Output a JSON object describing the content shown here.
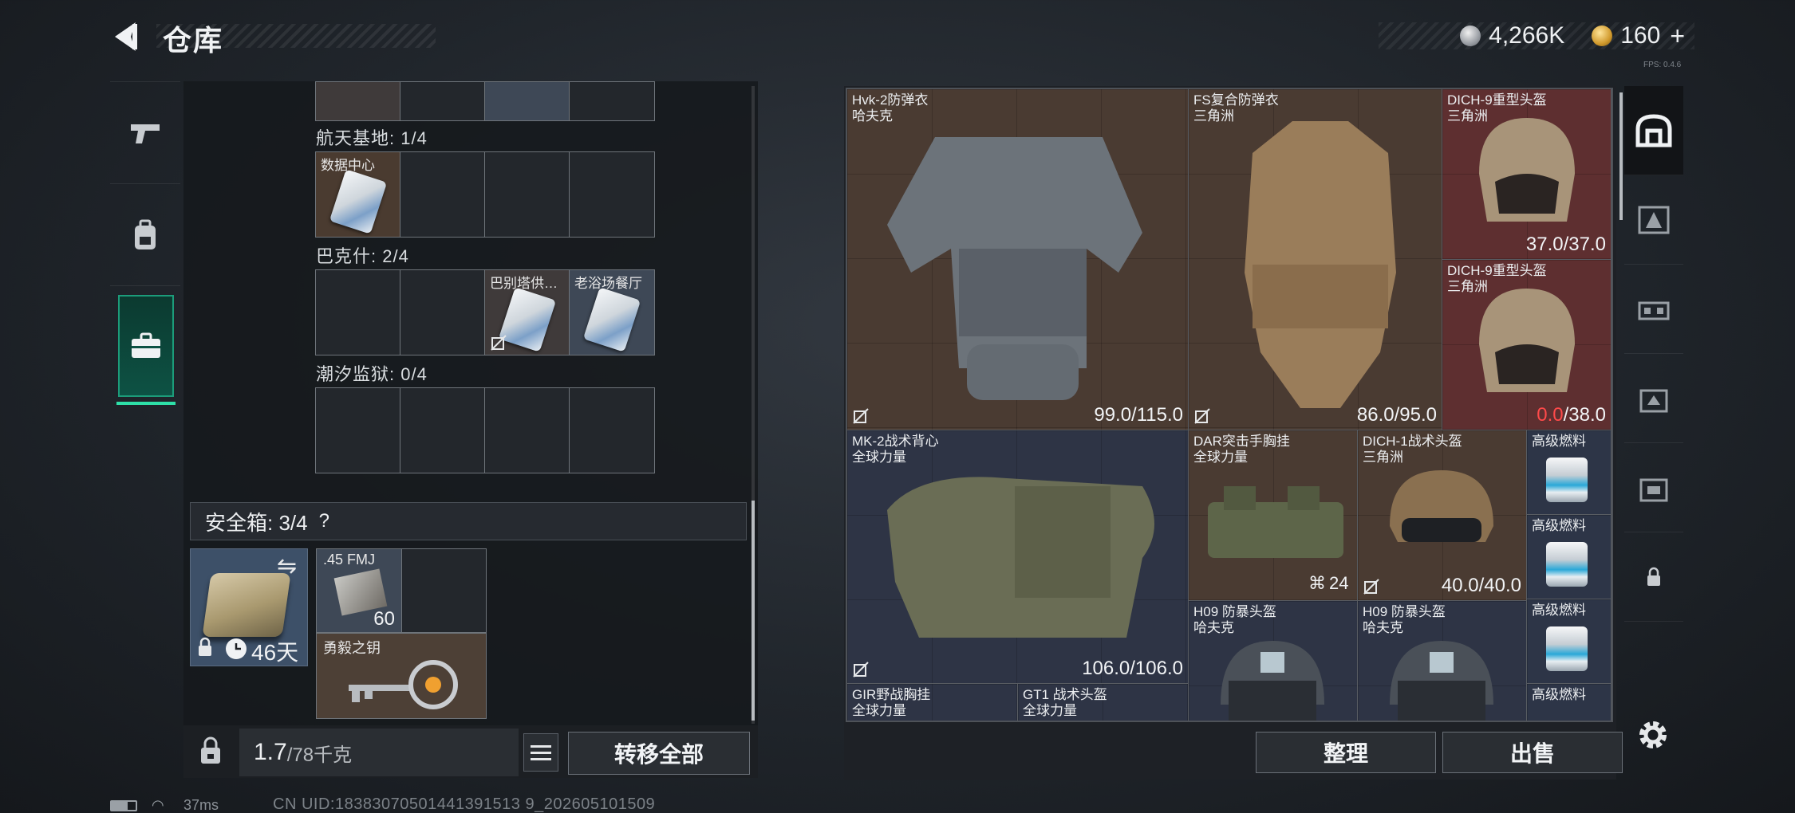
{
  "header": {
    "title": "仓库",
    "currency": [
      {
        "icon": "silver-coin-icon",
        "value": "4,266K"
      },
      {
        "icon": "gold-coin-icon",
        "value": "160"
      }
    ],
    "plus": "+",
    "fps_tag": "FPS: 0.4.6"
  },
  "left_rail": {
    "tabs": [
      {
        "icon": "pistol-icon",
        "active": false
      },
      {
        "icon": "backpack-icon",
        "active": false
      },
      {
        "icon": "vest-icon",
        "active": false
      },
      {
        "icon": "briefcase-icon",
        "active": true
      }
    ]
  },
  "stash": {
    "sections": [
      {
        "label": "航天基地: 1/4",
        "cells": [
          {
            "name": "数据中心",
            "filled": true
          },
          {
            "name": "",
            "filled": false
          },
          {
            "name": "",
            "filled": false
          },
          {
            "name": "",
            "filled": false
          }
        ]
      },
      {
        "label": "巴克什: 2/4",
        "cells": [
          {
            "name": "",
            "filled": false
          },
          {
            "name": "",
            "filled": false
          },
          {
            "name": "巴别塔供…",
            "filled": true
          },
          {
            "name": "老浴场餐厅",
            "filled": true
          }
        ]
      },
      {
        "label": "潮汐监狱: 0/4",
        "cells": [
          {
            "name": "",
            "filled": false
          },
          {
            "name": "",
            "filled": false
          },
          {
            "name": "",
            "filled": false
          },
          {
            "name": "",
            "filled": false
          }
        ]
      }
    ],
    "safe_box": {
      "title": "安全箱: 3/4",
      "help": "?",
      "days_left": "46天",
      "ammo_name": ".45 FMJ",
      "ammo_count": "60",
      "key_name": "勇毅之钥"
    },
    "weight": {
      "current": "1.7",
      "max": "/78千克"
    },
    "transfer_all": "转移全部"
  },
  "inventory": {
    "items": [
      {
        "name": "Hvk-2防弹衣",
        "origin": "哈夫克",
        "durability": "99.0/115.0"
      },
      {
        "name": "FS复合防弹衣",
        "origin": "三角洲",
        "durability": "86.0/95.0"
      },
      {
        "name": "DICH-9重型头盔",
        "origin": "三角洲",
        "durability": "37.0/37.0"
      },
      {
        "name": "DICH-9重型头盔",
        "origin": "三角洲",
        "durability_low": "0.0",
        "durability_max": "/38.0"
      },
      {
        "name": "MK-2战术背心",
        "origin": "全球力量",
        "durability": "106.0/106.0"
      },
      {
        "name": "DAR突击手胸挂",
        "origin": "全球力量",
        "count": "24"
      },
      {
        "name": "DICH-1战术头盔",
        "origin": "三角洲",
        "durability": "40.0/40.0"
      },
      {
        "name": "高级燃料"
      },
      {
        "name": "高级燃料"
      },
      {
        "name": "H09 防暴头盔",
        "origin": "哈夫克"
      },
      {
        "name": "H09 防暴头盔",
        "origin": "哈夫克"
      },
      {
        "name": "高级燃料"
      },
      {
        "name": "高级燃料"
      },
      {
        "name": "GIR野战胸挂",
        "origin": "全球力量"
      },
      {
        "name": "GT1 战术头盔",
        "origin": "全球力量"
      }
    ],
    "sort": "整理",
    "sell": "出售"
  },
  "right_rail": {
    "tabs": [
      {
        "icon": "helmet-slot-icon",
        "active": true
      },
      {
        "icon": "armor-slot-icon"
      },
      {
        "icon": "rig-slot-icon"
      },
      {
        "icon": "backpack-slot-icon"
      },
      {
        "icon": "case-slot-icon"
      },
      {
        "icon": "lock-icon"
      }
    ]
  },
  "status": {
    "ping": "37ms",
    "uid": "CN UID:18383070501441391513 9_202605101509"
  },
  "colors": {
    "accent_green": "#2ee0a8",
    "durability_low": "#ff4a4a",
    "item_brown": "#4a3b32",
    "item_red": "#5e2f30",
    "item_blue": "#2d3547"
  }
}
